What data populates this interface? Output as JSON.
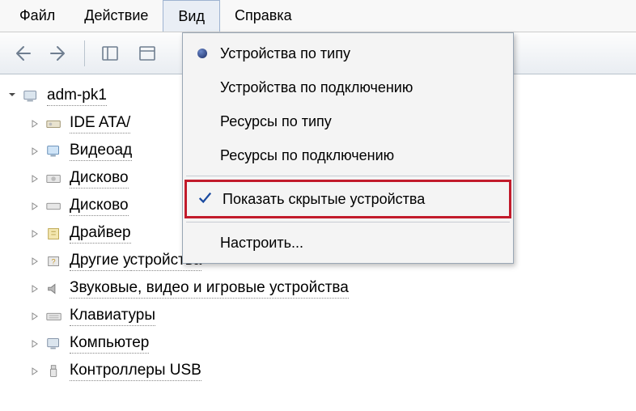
{
  "menubar": {
    "file": "Файл",
    "action": "Действие",
    "view": "Вид",
    "help": "Справка"
  },
  "dropdown": {
    "devices_by_type": "Устройства по типу",
    "devices_by_connection": "Устройства по подключению",
    "resources_by_type": "Ресурсы по типу",
    "resources_by_connection": "Ресурсы по подключению",
    "show_hidden": "Показать скрытые устройства",
    "customize": "Настроить..."
  },
  "tree": {
    "root": "adm-pk1",
    "items": [
      "IDE ATA/",
      "Видеоад",
      "Дисково",
      "Дисково",
      "Драйвер",
      "Другие у",
      "Звуковые, видео и игровые устройства",
      "Клавиатуры",
      "Компьютер",
      "Контроллеры USB"
    ],
    "long_suffix": "стройства"
  }
}
